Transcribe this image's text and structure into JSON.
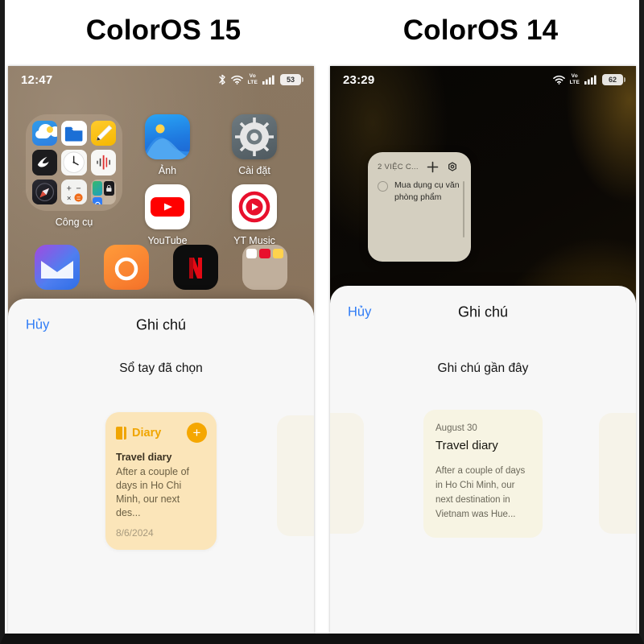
{
  "comparison": {
    "left_title": "ColorOS 15",
    "right_title": "ColorOS 14"
  },
  "left_phone": {
    "status_bar": {
      "time": "12:47",
      "bluetooth_icon": "bluetooth-icon",
      "wifi_icon": "wifi-icon",
      "volte_top": "Vo",
      "volte_bottom": "LTE",
      "signal_icon": "cellular-signal-icon",
      "battery_level": "53"
    },
    "home_screen": {
      "apps": [
        {
          "label": "Công cụ",
          "icon": "folder-icon"
        },
        {
          "label": "Ảnh",
          "icon": "photos-icon"
        },
        {
          "label": "Cài đặt",
          "icon": "settings-gear-icon"
        },
        {
          "label": "YouTube",
          "icon": "youtube-icon"
        },
        {
          "label": "YT Music",
          "icon": "youtube-music-icon"
        }
      ],
      "folder_apps": [
        "weather-icon",
        "files-icon",
        "notes-icon",
        "swift-icon",
        "clock-icon",
        "recorder-icon",
        "compass-icon",
        "calculator-icon",
        "subfolder-icon"
      ],
      "dock_apps": [
        "gmail-icon",
        "orange-app-icon",
        "netflix-icon",
        "dock-folder-icon"
      ]
    },
    "sheet": {
      "cancel_label": "Hủy",
      "title": "Ghi chú",
      "subtitle": "Sổ tay đã chọn",
      "card": {
        "brand": "Diary",
        "brand_icon": "book-icon",
        "add_icon": "plus-icon",
        "title": "Travel diary",
        "body": "After a couple of days in Ho Chi Minh, our next des...",
        "date": "8/6/2024"
      }
    }
  },
  "right_phone": {
    "status_bar": {
      "time": "23:29",
      "wifi_icon": "wifi-icon",
      "volte_top": "Vo",
      "volte_bottom": "LTE",
      "signal_icon": "cellular-signal-icon",
      "battery_level": "62"
    },
    "widget": {
      "title": "2 VIỆC C...",
      "add_icon": "plus-icon",
      "settings_icon": "gear-icon",
      "task_checkbox": "checkbox-unchecked-icon",
      "task_text": "Mua dụng cụ văn phòng phẩm"
    },
    "sheet": {
      "cancel_label": "Hủy",
      "title": "Ghi chú",
      "subtitle": "Ghi chú gần đây",
      "card": {
        "date": "August 30",
        "title": "Travel diary",
        "body": "After a couple of days in Ho Chi Minh, our next destination in Vietnam was Hue..."
      }
    }
  },
  "colors": {
    "accent_blue": "#2f7cf6",
    "diary_orange": "#f0a500",
    "sheet_bg": "#f7f7f7"
  }
}
